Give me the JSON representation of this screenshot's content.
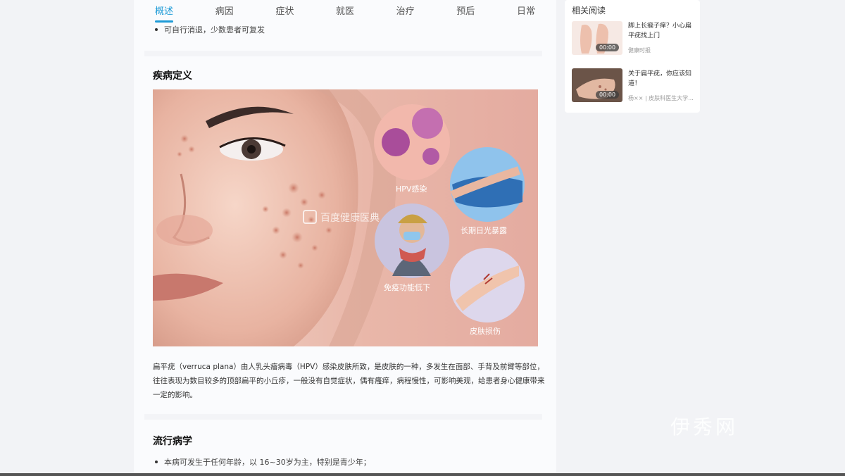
{
  "tabs": [
    "概述",
    "病因",
    "症状",
    "就医",
    "治疗",
    "预后",
    "日常"
  ],
  "active_tab": 0,
  "top_bullet": "可自行消退，少数患者可复发",
  "section_definition": "疾病定义",
  "image_labels": {
    "hpv": "HPV感染",
    "sun": "长期日光暴露",
    "immune": "免疫功能低下",
    "skin": "皮肤损伤",
    "watermark": "百度健康医典"
  },
  "definition_text": "扁平疣（verruca plana）由人乳头瘤病毒（HPV）感染皮肤所致，是皮肤的一种，多发生在面部、手背及前臂等部位，往往表现为数目较多的顶部扁平的小丘疹，一般没有自觉症状，偶有瘙痒，病程慢性，可影响美观，给患者身心健康带来一定的影响。",
  "section_epidemiology": "流行病学",
  "epi_bullet": "本病可发生于任何年龄，以 16~30岁为主，特别是青少年；",
  "sidebar": {
    "title": "相关阅读",
    "items": [
      {
        "text": "脚上长瘊子痒？小心扁平疣找上门",
        "meta": "健康时报",
        "duration": "00:00"
      },
      {
        "text": "关于扁平疣，你应该知道！",
        "meta": "杨××  |  皮肤科医生大学...",
        "duration": "00:00"
      }
    ]
  },
  "page_watermark": "伊秀网"
}
